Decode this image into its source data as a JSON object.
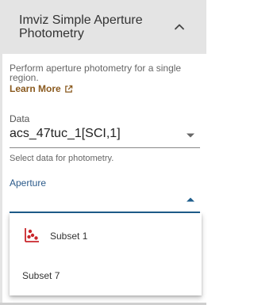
{
  "header": {
    "title": "Imviz Simple Aperture Photometry",
    "collapse_icon": "chevron-up-icon"
  },
  "description": "Perform aperture photometry for a single region.",
  "learn_more": {
    "label": "Learn More",
    "icon": "external-link-icon"
  },
  "data_field": {
    "label": "Data",
    "value": "acs_47tuc_1[SCI,1]",
    "hint": "Select data for photometry."
  },
  "aperture_field": {
    "label": "Aperture",
    "value": "",
    "options": [
      {
        "label": "Subset 1",
        "icon": "scatter-points-icon"
      },
      {
        "label": "Subset 7",
        "icon": ""
      }
    ]
  },
  "colors": {
    "header_bg": "#e4e4e4",
    "link": "#8a5a1f",
    "focus": "#1f5e8c",
    "subset_icon": "#c9262b"
  }
}
